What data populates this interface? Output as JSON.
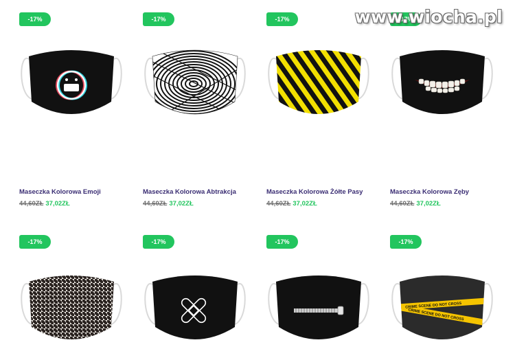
{
  "watermark": "www.wiocha.pl",
  "colors": {
    "accent": "#22c55e",
    "name": "#3a2d73",
    "old_price": "#6b6b6b"
  },
  "products": [
    {
      "badge": "-17%",
      "name": "Maseczka Kolorowa Emoji",
      "old_price": "44,60ZŁ",
      "new_price": "37,02ZŁ",
      "pattern": "emoji"
    },
    {
      "badge": "-17%",
      "name": "Maseczka Kolorowa Abtrakcja",
      "old_price": "44,60ZŁ",
      "new_price": "37,02ZŁ",
      "pattern": "optical-illusion"
    },
    {
      "badge": "-17%",
      "name": "Maseczka Kolorowa Żółte Pasy",
      "old_price": "44,60ZŁ",
      "new_price": "37,02ZŁ",
      "pattern": "yellow-black-stripes"
    },
    {
      "badge": "-17%",
      "name": "Maseczka Kolorowa Zęby",
      "old_price": "44,60ZŁ",
      "new_price": "37,02ZŁ",
      "pattern": "teeth-smile"
    },
    {
      "badge": "-17%",
      "pattern": "houndstooth"
    },
    {
      "badge": "-17%",
      "pattern": "bandage-cross"
    },
    {
      "badge": "-17%",
      "pattern": "zipper"
    },
    {
      "badge": "-17%",
      "pattern": "crime-scene-tape",
      "tape_text": "CRIME SCENE DO NOT CROSS"
    }
  ]
}
